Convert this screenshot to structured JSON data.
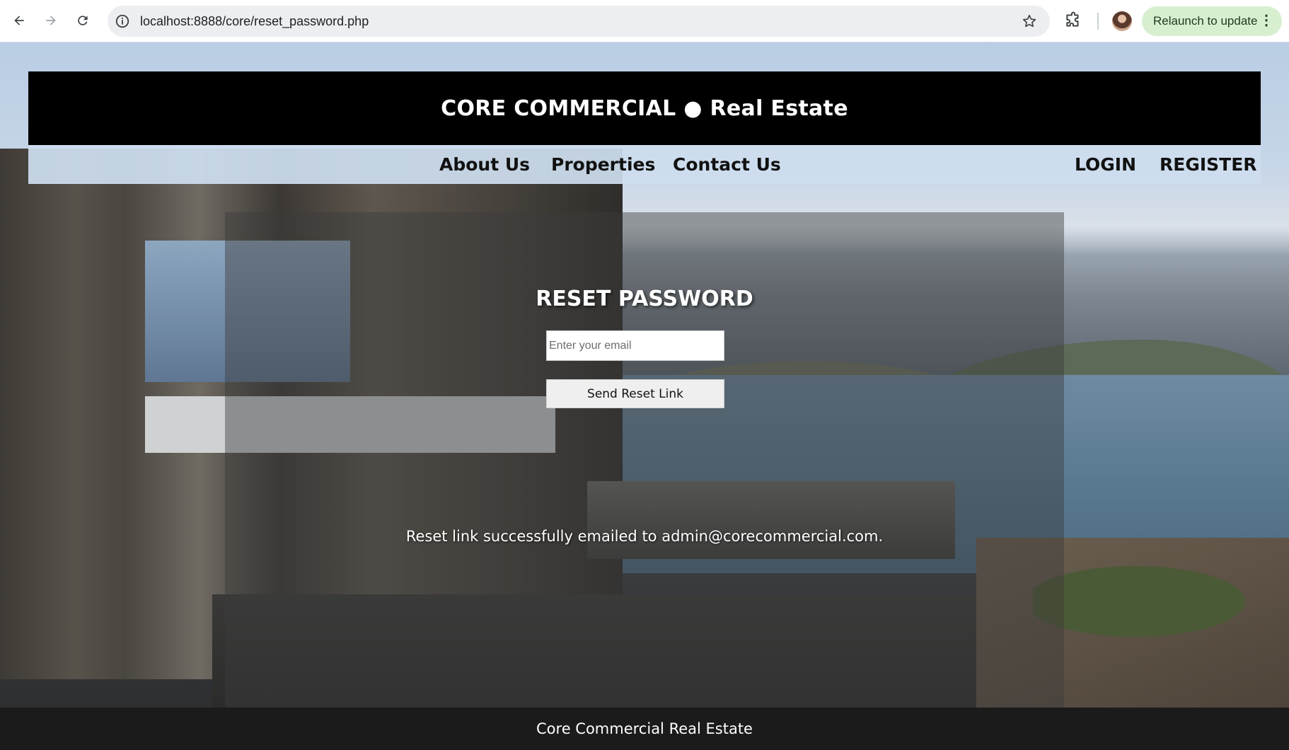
{
  "browser": {
    "url": "localhost:8888/core/reset_password.php",
    "relaunch_label": "Relaunch to update"
  },
  "header": {
    "title": "CORE COMMERCIAL ● Real Estate"
  },
  "nav": {
    "about": "About Us",
    "properties": "Properties",
    "contact": "Contact Us",
    "login": "LOGIN",
    "register": "REGISTER"
  },
  "reset": {
    "title": "RESET PASSWORD",
    "email_placeholder": "Enter your email",
    "email_value": "",
    "send_label": "Send Reset Link",
    "status_message": "Reset link successfully emailed to admin@corecommercial.com."
  },
  "footer": {
    "text": "Core Commercial Real Estate"
  },
  "icons": {
    "back": "back-arrow-icon",
    "forward": "forward-arrow-icon",
    "reload": "reload-icon",
    "info": "info-icon",
    "bookmark": "star-icon",
    "extensions": "puzzle-icon",
    "menu": "kebab-menu-icon"
  }
}
